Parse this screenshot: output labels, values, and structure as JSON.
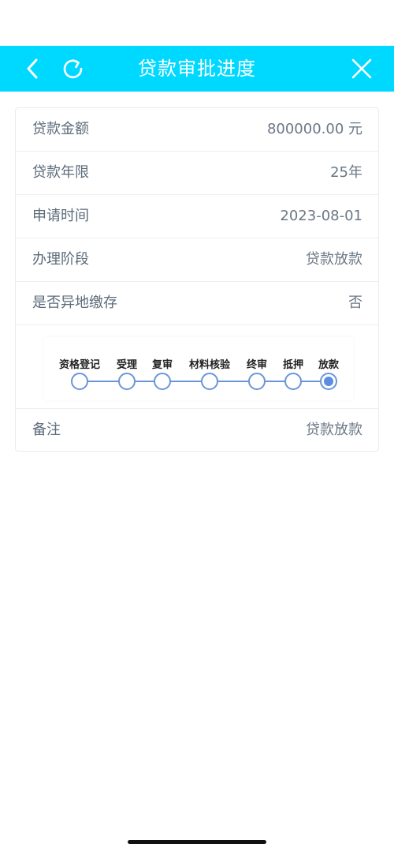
{
  "header": {
    "title": "贷款审批进度",
    "back_icon": "chevron-left-icon",
    "refresh_icon": "refresh-icon",
    "close_icon": "close-icon"
  },
  "colors": {
    "brand": "#00d9ff",
    "step_active": "#5b8de0",
    "step_line": "#6b95d8"
  },
  "details": [
    {
      "label": "贷款金额",
      "value": "800000.00 元"
    },
    {
      "label": "贷款年限",
      "value": "25年"
    },
    {
      "label": "申请时间",
      "value": "2023-08-01"
    },
    {
      "label": "办理阶段",
      "value": "贷款放款"
    },
    {
      "label": "是否异地缴存",
      "value": "否"
    }
  ],
  "progress": {
    "steps": [
      "资格登记",
      "受理",
      "复审",
      "材料核验",
      "终审",
      "抵押",
      "放款"
    ],
    "current_index": 6
  },
  "remark": {
    "label": "备注",
    "value": "贷款放款"
  }
}
